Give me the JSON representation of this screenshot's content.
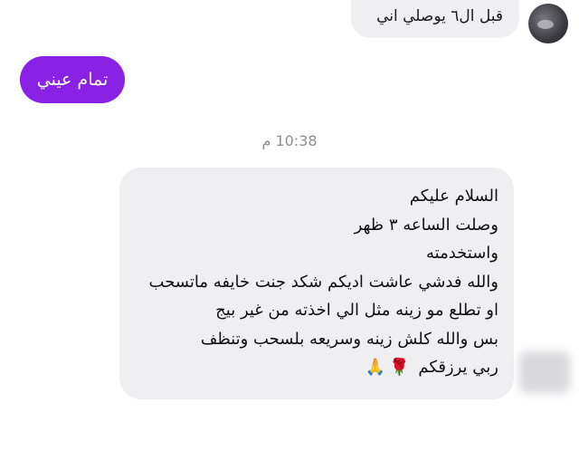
{
  "messages": {
    "top_partial": {
      "text": "قبل ال٦ يوصلي اني"
    },
    "outgoing": {
      "text": "تمام عيني"
    },
    "timestamp": "10:38 م",
    "incoming": {
      "lines": [
        "السلام عليكم",
        "وصلت الساعه ٣ ظهر",
        "واستخدمته",
        "والله فدشي عاشت اديكم شكد جنت خايفه ماتسحب",
        "او تطلع مو زينه مثل الي اخذته من غير بيج",
        "بس والله كلش زينه وسريعه بلسحب وتنظف",
        "ربي يرزقكم"
      ],
      "emojis": {
        "rose": "🌹",
        "pray": "🙏"
      }
    }
  },
  "colors": {
    "outgoing_bubble": "#8a22e6",
    "incoming_bubble": "#efeff1",
    "timestamp": "#8e8e93"
  },
  "icons": {
    "top_avatar": "avatar",
    "bottom_avatar": "avatar-blurred"
  }
}
